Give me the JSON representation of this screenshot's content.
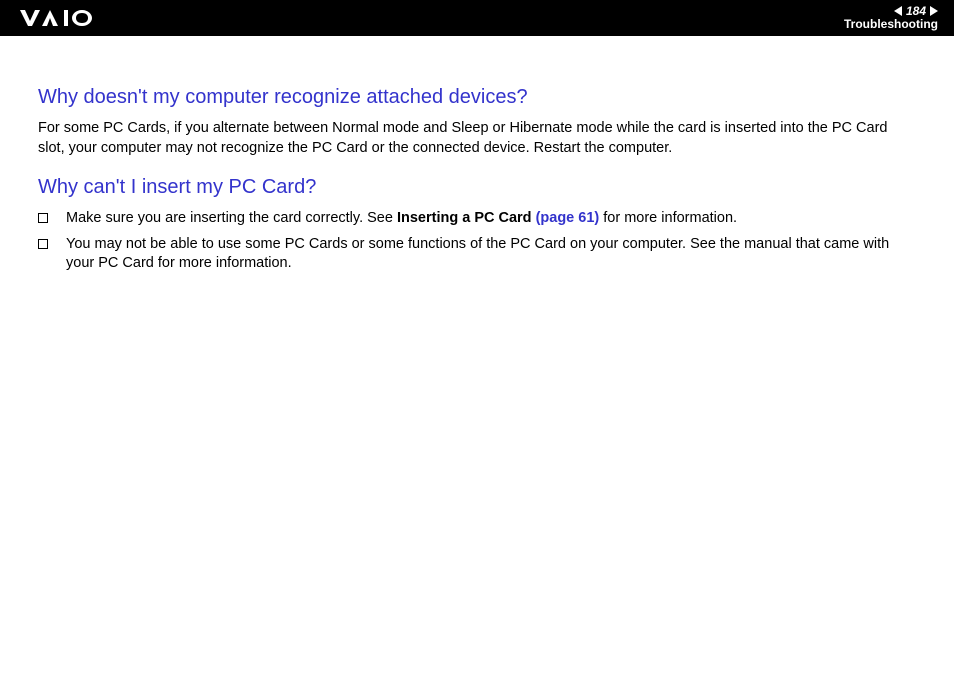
{
  "header": {
    "page_number": "184",
    "section": "Troubleshooting"
  },
  "content": {
    "heading1": "Why doesn't my computer recognize attached devices?",
    "paragraph1": "For some PC Cards, if you alternate between Normal mode and Sleep or Hibernate mode while the card is inserted into the PC Card slot, your computer may not recognize the PC Card or the connected device. Restart the computer.",
    "heading2": "Why can't I insert my PC Card?",
    "bullets": [
      {
        "prefix": "Make sure you are inserting the card correctly. See ",
        "bold_text": "Inserting a PC Card ",
        "link_text": "(page 61)",
        "suffix": " for more information."
      },
      {
        "text": "You may not be able to use some PC Cards or some functions of the PC Card on your computer. See the manual that came with your PC Card for more information."
      }
    ]
  }
}
